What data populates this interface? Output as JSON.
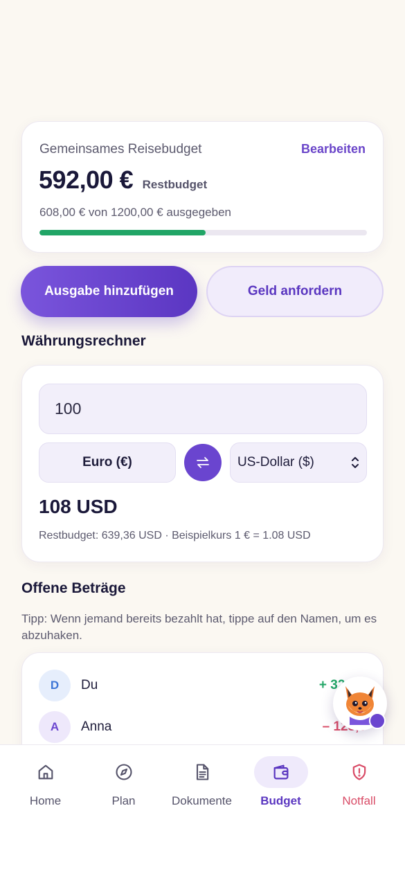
{
  "budget": {
    "title": "Gemeinsames Reisebudget",
    "edit_label": "Bearbeiten",
    "remaining_amount": "592,00 €",
    "remaining_label": "Restbudget",
    "spent_text": "608,00 € von 1200,00 € ausgegeben",
    "progress_fraction": 0.5067
  },
  "actions": {
    "add_expense": "Ausgabe hinzufügen",
    "request_money": "Geld anfordern"
  },
  "converter": {
    "title": "Währungsrechner",
    "amount_value": "100",
    "from_currency": "Euro (€)",
    "to_currency": "US-Dollar ($)",
    "result": "108 USD",
    "note": "Restbudget: 639,36 USD · Beispielkurs 1 € = 1.08 USD"
  },
  "open_amounts": {
    "title": "Offene Beträge",
    "tip": "Tipp: Wenn jemand bereits bezahlt hat, tippe auf den Namen, um es abzuhaken.",
    "rows": [
      {
        "initial": "D",
        "name": "Du",
        "amount": "+ 320",
        "color": "#21a566",
        "avatar_bg": "#e6eefc",
        "avatar_fg": "#3e76d6"
      },
      {
        "initial": "A",
        "name": "Anna",
        "amount": "– 128,0",
        "color": "#d94c67",
        "avatar_bg": "#eee8fb",
        "avatar_fg": "#6a45cf"
      }
    ]
  },
  "nav": {
    "items": [
      {
        "label": "Home",
        "icon": "home-icon"
      },
      {
        "label": "Plan",
        "icon": "compass-icon"
      },
      {
        "label": "Dokumente",
        "icon": "document-icon"
      },
      {
        "label": "Budget",
        "icon": "wallet-icon",
        "active": true
      },
      {
        "label": "Notfall",
        "icon": "shield-alert-icon"
      }
    ]
  },
  "colors": {
    "accent": "#6a45cf",
    "positive": "#21a566",
    "negative": "#d94c67",
    "background": "#fbf8f2"
  }
}
